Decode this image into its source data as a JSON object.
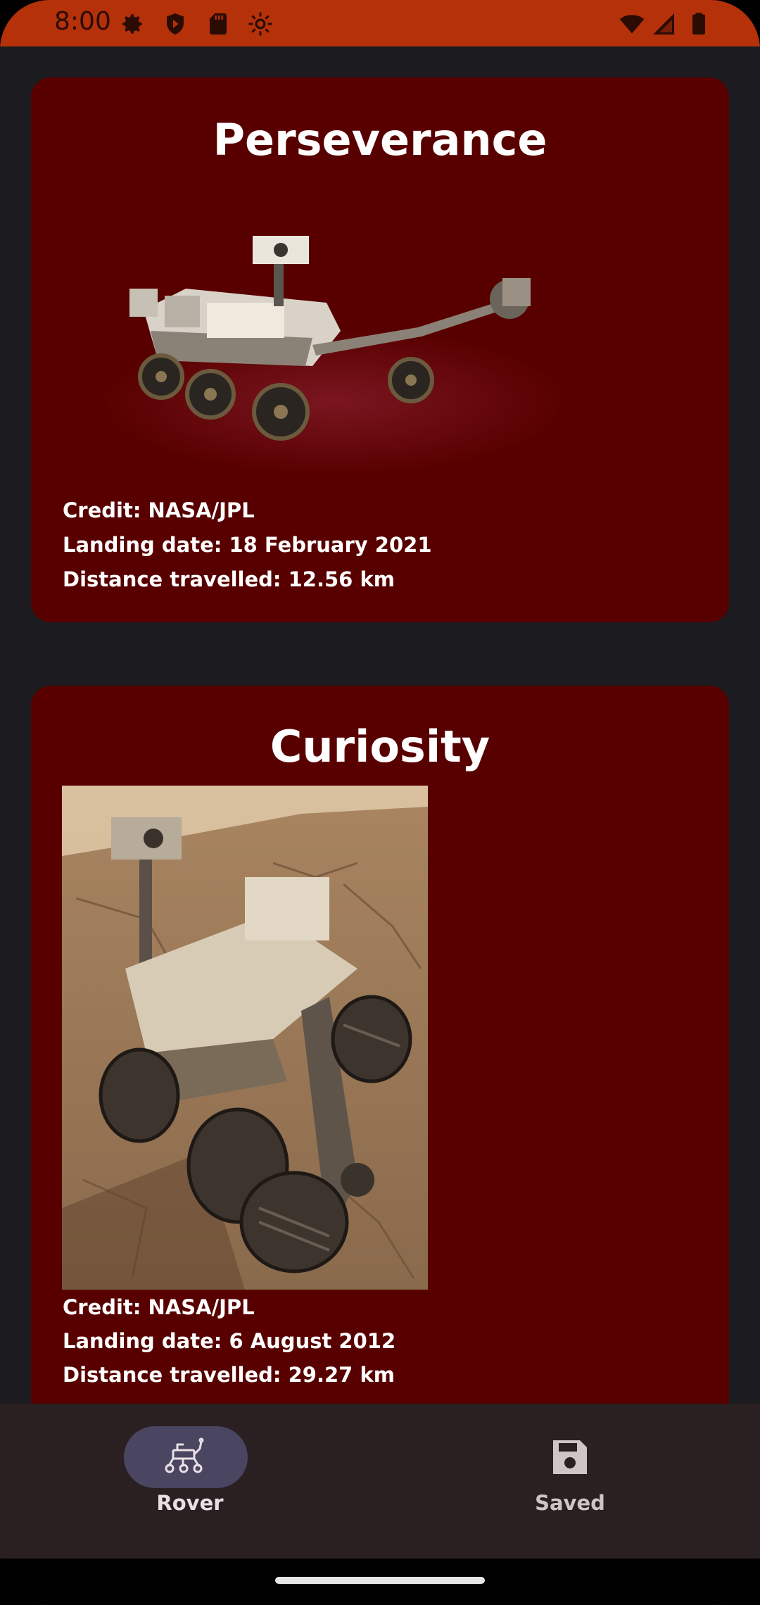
{
  "status_bar": {
    "time": "8:00",
    "left_icons": [
      "gear-icon",
      "shield-play-icon",
      "sd-card-icon",
      "debug-gear-icon"
    ],
    "right_icons": [
      "wifi-icon",
      "signal-icon",
      "battery-icon"
    ],
    "background": "#b53109"
  },
  "rovers": [
    {
      "name": "Perseverance",
      "credit": "Credit: NASA/JPL",
      "landing_date": "Landing date: 18 February 2021",
      "distance": "Distance travelled: 12.56 km"
    },
    {
      "name": "Curiosity",
      "credit": "Credit: NASA/JPL",
      "landing_date": "Landing date: 6 August 2012",
      "distance": "Distance travelled: 29.27 km"
    }
  ],
  "nav": {
    "items": [
      {
        "label": "Rover",
        "icon": "rover-icon",
        "selected": true
      },
      {
        "label": "Saved",
        "icon": "save-icon",
        "selected": false
      }
    ]
  },
  "colors": {
    "card_background": "#580000",
    "app_background": "#1c1b20",
    "nav_background": "#2a1f21",
    "nav_selected_pill": "#4a4560",
    "nav_selected_text": "#e8e0e4",
    "nav_unselected_text": "#cfc4c6"
  }
}
